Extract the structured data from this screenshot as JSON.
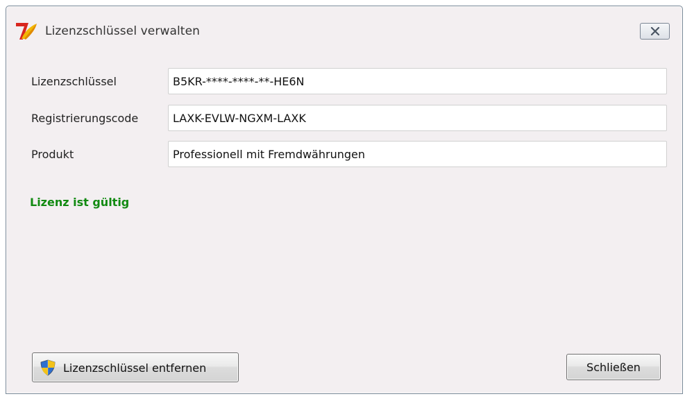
{
  "window": {
    "title": "Lizenzschlüssel verwalten"
  },
  "form": {
    "license_key": {
      "label": "Lizenzschlüssel",
      "value": "B5KR-****-****-**-HE6N"
    },
    "registration_code": {
      "label": "Registrierungscode",
      "value": "LAXK-EVLW-NGXM-LAXK"
    },
    "product": {
      "label": "Produkt",
      "value": "Professionell mit Fremdwährungen"
    }
  },
  "status": {
    "text": "Lizenz ist gültig",
    "color": "#128a12"
  },
  "buttons": {
    "remove_label": "Lizenzschlüssel entfernen",
    "remove_icon": "uac-shield-icon",
    "close_label": "Schließen"
  },
  "icons": {
    "app": "app-logo-icon",
    "close": "close-icon"
  }
}
